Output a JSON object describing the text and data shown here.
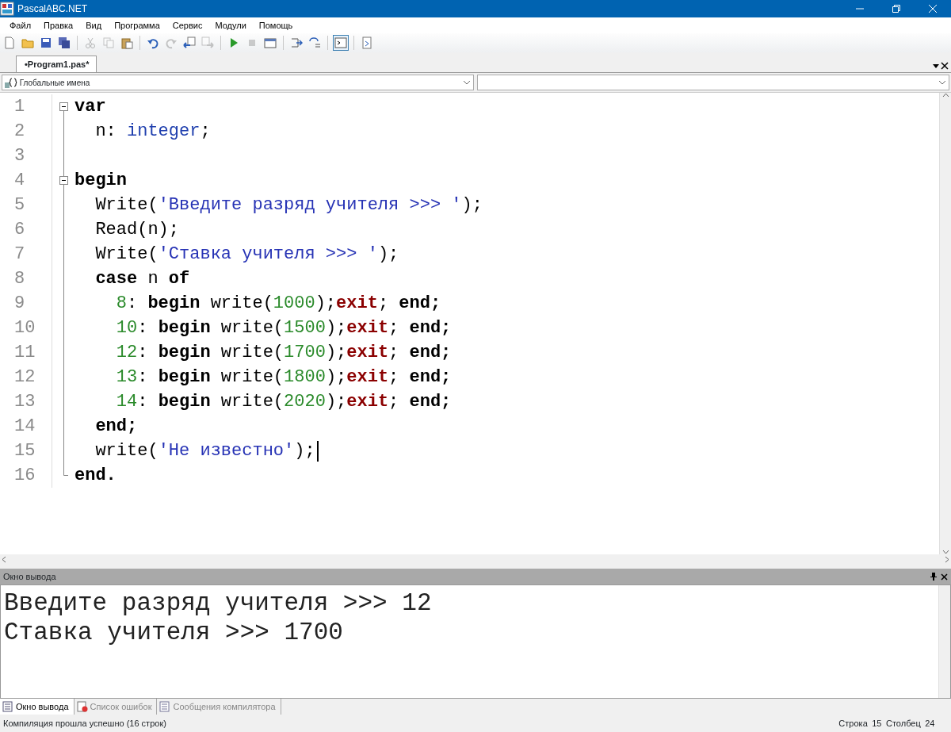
{
  "window": {
    "title": "PascalABC.NET"
  },
  "menu": [
    "Файл",
    "Правка",
    "Вид",
    "Программа",
    "Сервис",
    "Модули",
    "Помощь"
  ],
  "toolbar": [
    {
      "kind": "new",
      "disabled": false,
      "pressed": false
    },
    {
      "kind": "open",
      "disabled": false,
      "pressed": false
    },
    {
      "kind": "save",
      "disabled": false,
      "pressed": false
    },
    {
      "kind": "saveall",
      "disabled": false,
      "pressed": false
    },
    {
      "kind": "sep"
    },
    {
      "kind": "cut",
      "disabled": true,
      "pressed": false
    },
    {
      "kind": "copy",
      "disabled": true,
      "pressed": false
    },
    {
      "kind": "paste",
      "disabled": false,
      "pressed": false
    },
    {
      "kind": "sep"
    },
    {
      "kind": "undo",
      "disabled": false,
      "pressed": false
    },
    {
      "kind": "redo",
      "disabled": true,
      "pressed": false
    },
    {
      "kind": "back",
      "disabled": false,
      "pressed": false
    },
    {
      "kind": "fwd",
      "disabled": true,
      "pressed": false
    },
    {
      "kind": "sep"
    },
    {
      "kind": "run",
      "disabled": false,
      "pressed": false
    },
    {
      "kind": "stop",
      "disabled": true,
      "pressed": false
    },
    {
      "kind": "debug",
      "disabled": false,
      "pressed": false
    },
    {
      "kind": "sep"
    },
    {
      "kind": "stepin",
      "disabled": false,
      "pressed": false
    },
    {
      "kind": "stepover",
      "disabled": false,
      "pressed": false
    },
    {
      "kind": "sep"
    },
    {
      "kind": "console",
      "disabled": false,
      "pressed": true
    },
    {
      "kind": "sep"
    },
    {
      "kind": "page",
      "disabled": false,
      "pressed": false
    }
  ],
  "tabs": [
    {
      "label": "•Program1.pas*",
      "selected": true
    }
  ],
  "scope_combo": {
    "value": "Глобальные имена"
  },
  "editor": {
    "lines": [
      {
        "number": "1",
        "kind": "fold_start",
        "caret": false,
        "tokens": [
          {
            "t": "var",
            "kind": "kw"
          }
        ]
      },
      {
        "number": "2",
        "caret": false,
        "tokens": [
          {
            "t": "  n: ",
            "kind": "plain"
          },
          {
            "t": "integer",
            "kind": "type"
          },
          {
            "t": ";",
            "kind": "plain"
          }
        ]
      },
      {
        "number": "3",
        "caret": false
      },
      {
        "number": "4",
        "kind": "fold_start",
        "caret": false,
        "tokens": [
          {
            "t": "begin",
            "kind": "kw"
          }
        ]
      },
      {
        "number": "5",
        "caret": false,
        "tokens": [
          {
            "t": "  Write(",
            "kind": "plain"
          },
          {
            "t": "'Введите разряд учителя >>> '",
            "kind": "str"
          },
          {
            "t": ");",
            "kind": "plain"
          }
        ]
      },
      {
        "number": "6",
        "caret": false,
        "tokens": [
          {
            "t": "  Read(n);",
            "kind": "plain"
          }
        ]
      },
      {
        "number": "7",
        "caret": false,
        "tokens": [
          {
            "t": "  Write(",
            "kind": "plain"
          },
          {
            "t": "'Ставка учителя >>> '",
            "kind": "str"
          },
          {
            "t": ");",
            "kind": "plain"
          }
        ]
      },
      {
        "number": "8",
        "caret": false,
        "tokens": [
          {
            "t": "  case",
            "kind": "kw"
          },
          {
            "t": " n ",
            "kind": "plain"
          },
          {
            "t": "of",
            "kind": "kw"
          }
        ]
      },
      {
        "number": "9",
        "caret": false,
        "tokens": [
          {
            "t": "    8",
            "kind": "num"
          },
          {
            "t": ": ",
            "kind": "plain"
          },
          {
            "t": "begin",
            "kind": "kw"
          },
          {
            "t": " write(",
            "kind": "plain"
          },
          {
            "t": "1000",
            "kind": "num"
          },
          {
            "t": ");",
            "kind": "plain"
          },
          {
            "t": "exit",
            "kind": "exit"
          },
          {
            "t": "; ",
            "kind": "plain"
          },
          {
            "t": "end;",
            "kind": "kw"
          }
        ]
      },
      {
        "number": "10",
        "caret": false,
        "tokens": [
          {
            "t": "    10",
            "kind": "num"
          },
          {
            "t": ": ",
            "kind": "plain"
          },
          {
            "t": "begin",
            "kind": "kw"
          },
          {
            "t": " write(",
            "kind": "plain"
          },
          {
            "t": "1500",
            "kind": "num"
          },
          {
            "t": ");",
            "kind": "plain"
          },
          {
            "t": "exit",
            "kind": "exit"
          },
          {
            "t": "; ",
            "kind": "plain"
          },
          {
            "t": "end;",
            "kind": "kw"
          }
        ]
      },
      {
        "number": "11",
        "caret": false,
        "tokens": [
          {
            "t": "    12",
            "kind": "num"
          },
          {
            "t": ": ",
            "kind": "plain"
          },
          {
            "t": "begin",
            "kind": "kw"
          },
          {
            "t": " write(",
            "kind": "plain"
          },
          {
            "t": "1700",
            "kind": "num"
          },
          {
            "t": ");",
            "kind": "plain"
          },
          {
            "t": "exit",
            "kind": "exit"
          },
          {
            "t": "; ",
            "kind": "plain"
          },
          {
            "t": "end;",
            "kind": "kw"
          }
        ]
      },
      {
        "number": "12",
        "caret": false,
        "tokens": [
          {
            "t": "    13",
            "kind": "num"
          },
          {
            "t": ": ",
            "kind": "plain"
          },
          {
            "t": "begin",
            "kind": "kw"
          },
          {
            "t": " write(",
            "kind": "plain"
          },
          {
            "t": "1800",
            "kind": "num"
          },
          {
            "t": ");",
            "kind": "plain"
          },
          {
            "t": "exit",
            "kind": "exit"
          },
          {
            "t": "; ",
            "kind": "plain"
          },
          {
            "t": "end;",
            "kind": "kw"
          }
        ]
      },
      {
        "number": "13",
        "caret": false,
        "tokens": [
          {
            "t": "    14",
            "kind": "num"
          },
          {
            "t": ": ",
            "kind": "plain"
          },
          {
            "t": "begin",
            "kind": "kw"
          },
          {
            "t": " write(",
            "kind": "plain"
          },
          {
            "t": "2020",
            "kind": "num"
          },
          {
            "t": ");",
            "kind": "plain"
          },
          {
            "t": "exit",
            "kind": "exit"
          },
          {
            "t": "; ",
            "kind": "plain"
          },
          {
            "t": "end;",
            "kind": "kw"
          }
        ]
      },
      {
        "number": "14",
        "caret": false,
        "tokens": [
          {
            "t": "  end;",
            "kind": "kw"
          }
        ]
      },
      {
        "number": "15",
        "caret": true,
        "tokens": [
          {
            "t": "  write(",
            "kind": "plain"
          },
          {
            "t": "'Не известно'",
            "kind": "str"
          },
          {
            "t": ");",
            "kind": "plain"
          }
        ]
      },
      {
        "number": "16",
        "kind": "fold_end",
        "caret": false,
        "tokens": [
          {
            "t": "end.",
            "kind": "kw"
          }
        ]
      }
    ]
  },
  "output": {
    "title": "Окно вывода",
    "lines": [
      "Введите разряд учителя >>> 12",
      "Ставка учителя >>> 1700"
    ]
  },
  "bottom_tabs": [
    {
      "label": "Окно вывода",
      "kind": "output",
      "selected": true
    },
    {
      "label": "Список ошибок",
      "kind": "errors",
      "selected": false
    },
    {
      "label": "Сообщения компилятора",
      "kind": "messages",
      "selected": false
    }
  ],
  "status_bar": {
    "message": "Компиляция прошла успешно (16 строк)",
    "line_label": "Строка",
    "line": "15",
    "column_label": "Столбец",
    "column": "24"
  }
}
